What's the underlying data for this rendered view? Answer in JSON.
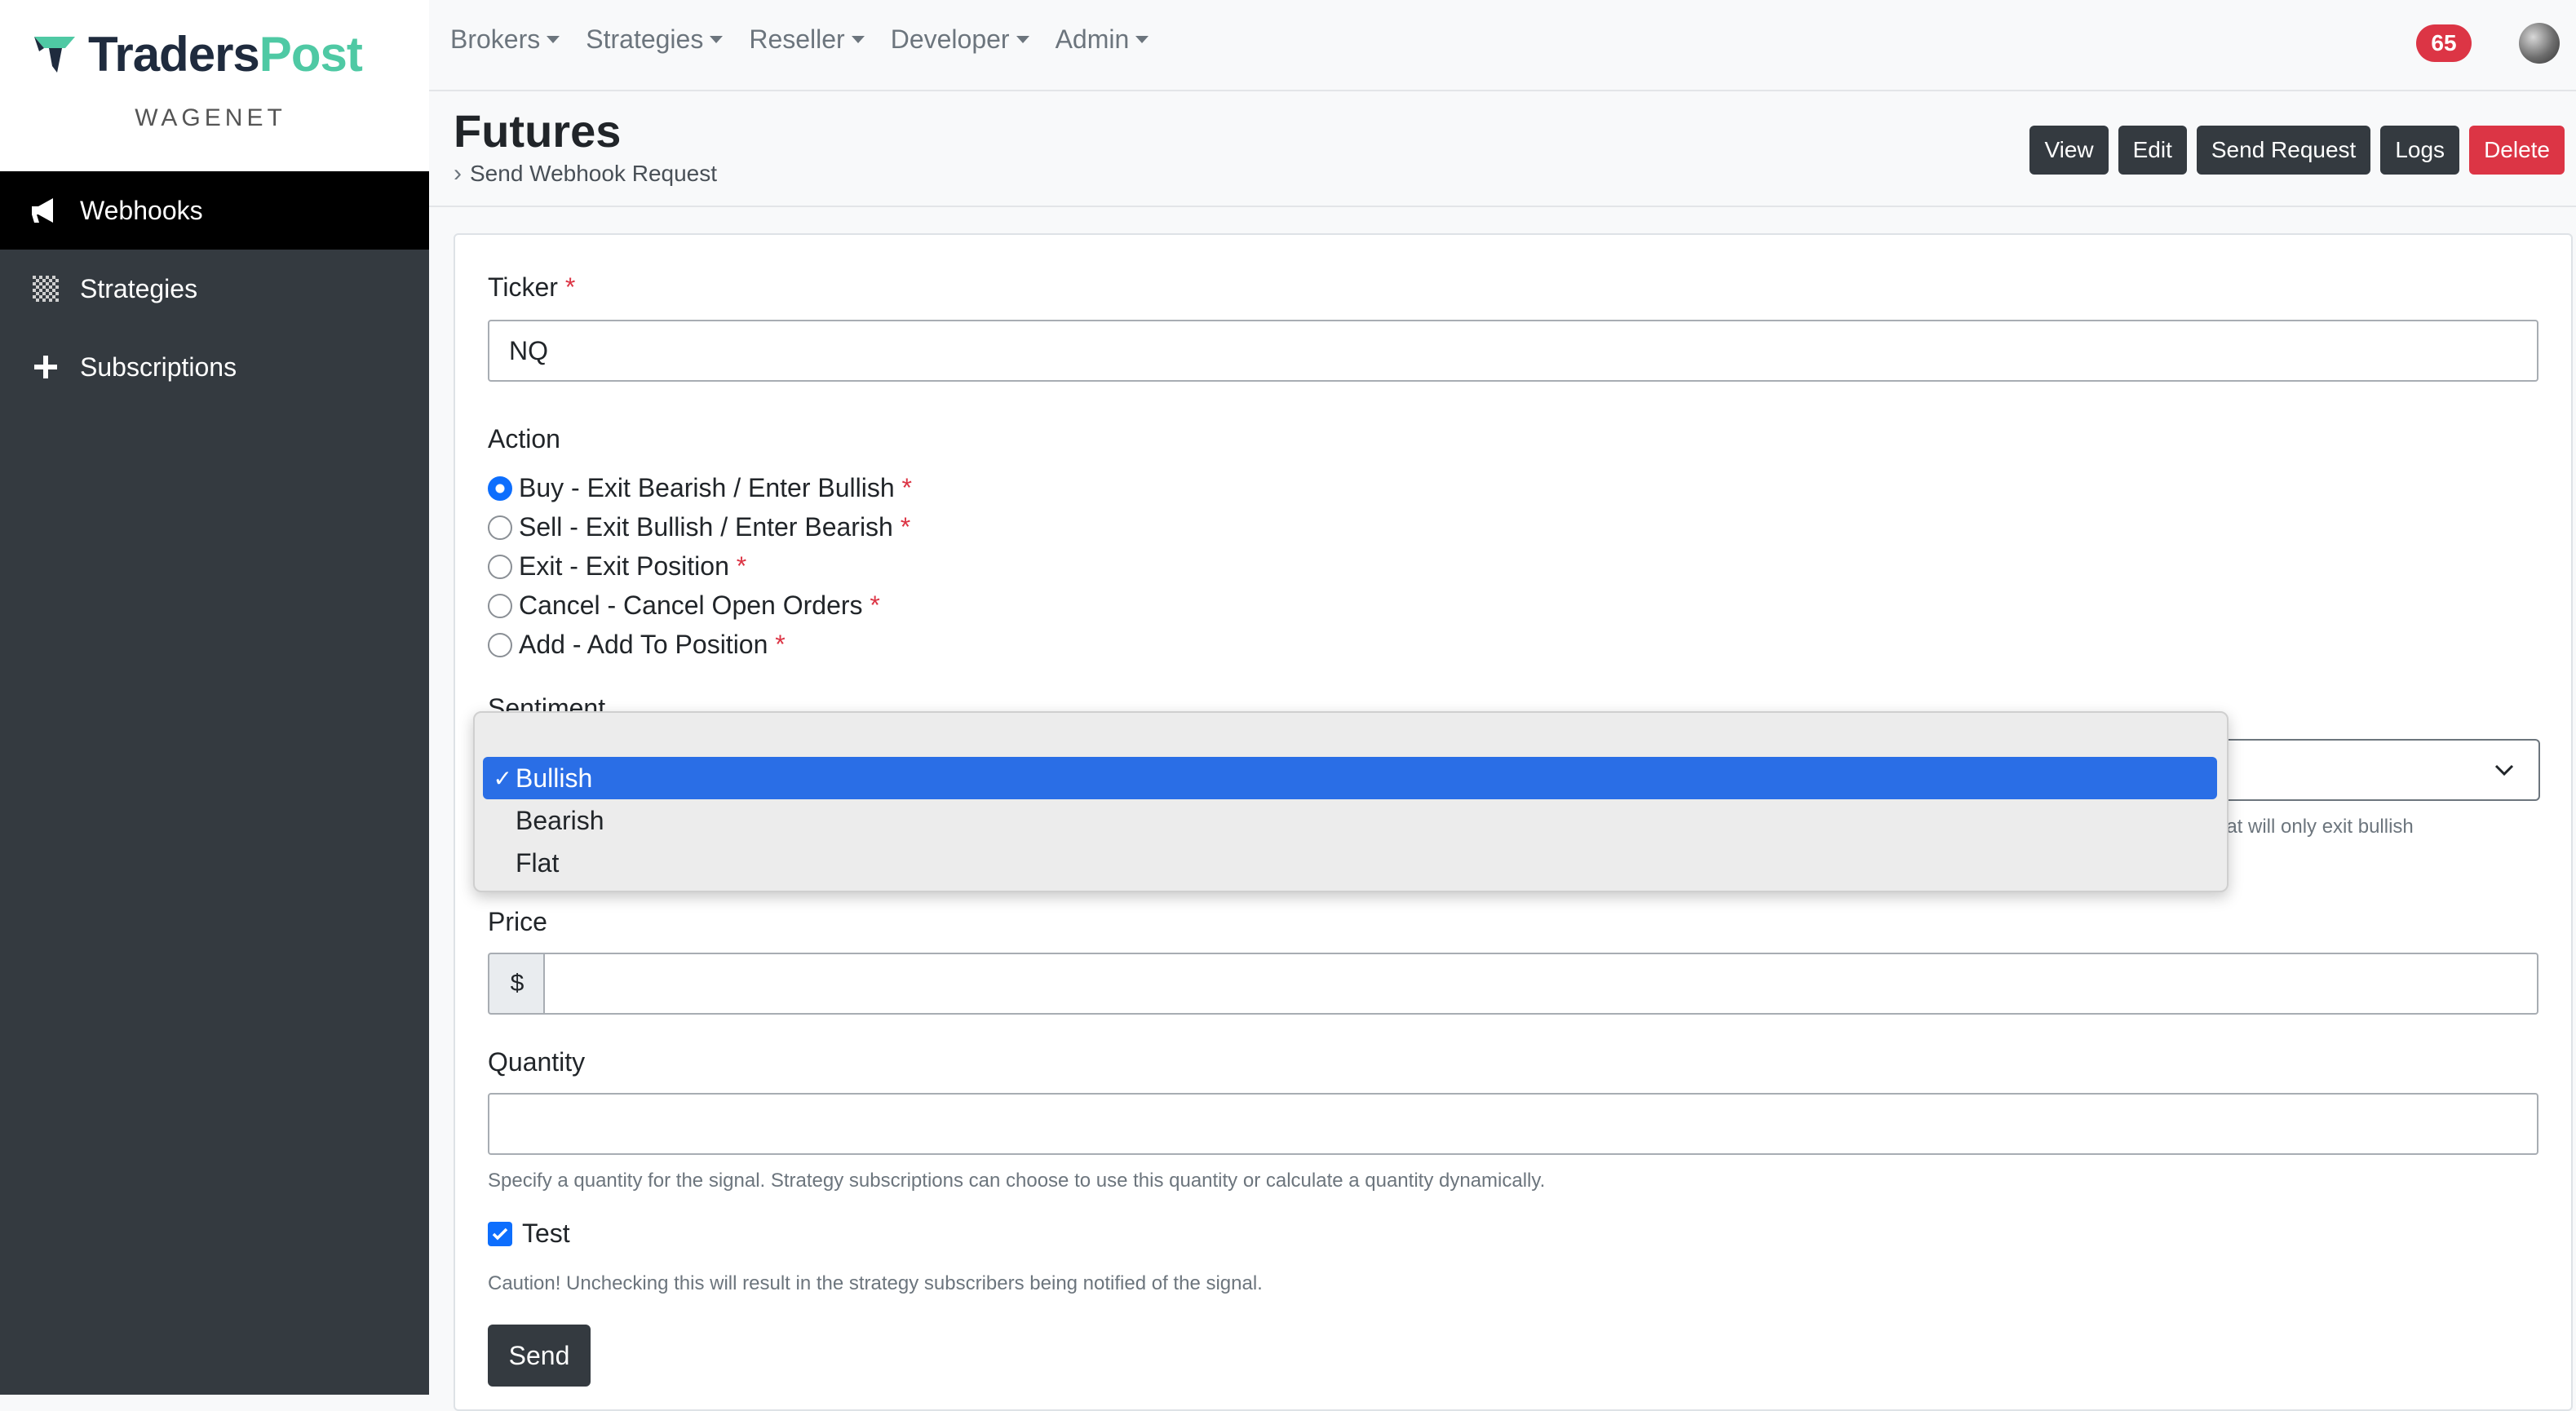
{
  "brand": {
    "name_part1": "Traders",
    "name_part2": "Post",
    "subtitle": "WAGENET",
    "logo_color": "#1f2b3e",
    "accent_color": "#4fc9a4"
  },
  "sidebar": {
    "items": [
      {
        "label": "Webhooks",
        "icon": "megaphone-icon",
        "active": true
      },
      {
        "label": "Strategies",
        "icon": "checkerboard-icon",
        "active": false
      },
      {
        "label": "Subscriptions",
        "icon": "plus-icon",
        "active": false
      }
    ]
  },
  "topnav": {
    "items": [
      {
        "label": "Brokers"
      },
      {
        "label": "Strategies"
      },
      {
        "label": "Reseller"
      },
      {
        "label": "Developer"
      },
      {
        "label": "Admin"
      }
    ],
    "notification_count": "65",
    "notification_color": "#dc3545"
  },
  "header": {
    "title": "Futures",
    "breadcrumb": "Send Webhook Request",
    "actions": [
      {
        "label": "View"
      },
      {
        "label": "Edit"
      },
      {
        "label": "Send Request"
      },
      {
        "label": "Logs"
      },
      {
        "label": "Delete",
        "variant": "danger"
      }
    ]
  },
  "form": {
    "ticker": {
      "label": "Ticker",
      "required_mark": "*",
      "value": "NQ"
    },
    "action": {
      "label": "Action",
      "options": [
        {
          "label": "Buy - Exit Bearish / Enter Bullish",
          "required_mark": "*",
          "checked": true
        },
        {
          "label": "Sell - Exit Bullish / Enter Bearish",
          "required_mark": "*",
          "checked": false
        },
        {
          "label": "Exit - Exit Position",
          "required_mark": "*",
          "checked": false
        },
        {
          "label": "Cancel - Cancel Open Orders",
          "required_mark": "*",
          "checked": false
        },
        {
          "label": "Add - Add To Position",
          "required_mark": "*",
          "checked": false
        }
      ]
    },
    "sentiment": {
      "label": "Sentiment",
      "help_visible": "f flat will only exit bullish",
      "options": [
        {
          "label": "Bullish",
          "selected": true
        },
        {
          "label": "Bearish",
          "selected": false
        },
        {
          "label": "Flat",
          "selected": false
        }
      ],
      "check_mark": "✓"
    },
    "price": {
      "label": "Price",
      "prefix": "$",
      "value": ""
    },
    "quantity": {
      "label": "Quantity",
      "value": "",
      "help": "Specify a quantity for the signal. Strategy subscriptions can choose to use this quantity or calculate a quantity dynamically."
    },
    "test": {
      "label": "Test",
      "checked": true,
      "help": "Caution! Unchecking this will result in the strategy subscribers being notified of the signal."
    },
    "submit_label": "Send"
  }
}
